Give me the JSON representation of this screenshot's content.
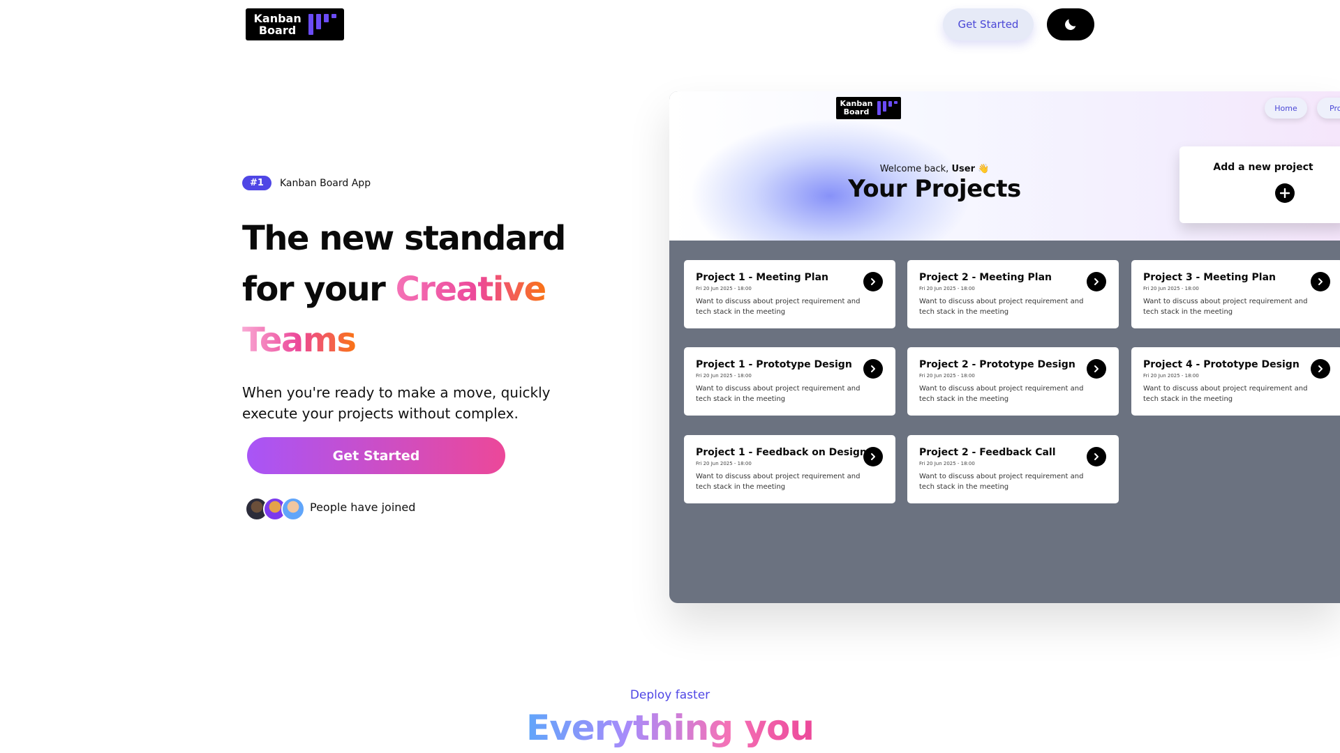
{
  "header": {
    "logo_text": "Kanban Board",
    "get_started_label": "Get Started",
    "theme_toggle_icon": "moon-icon"
  },
  "hero": {
    "badge": "#1",
    "badge_label": "Kanban Board App",
    "headline_line1": "The new standard",
    "headline_line2_prefix": "for your ",
    "headline_highlight1": "Creative",
    "headline_highlight2": "Teams",
    "subtext": "When you're ready to make a move, quickly execute your projects without complex.",
    "cta_label": "Get Started",
    "joined_text": "People have joined"
  },
  "preview": {
    "logo_text": "Kanban Board",
    "nav": [
      "Home",
      "Pro"
    ],
    "welcome_prefix": "Welcome back, ",
    "welcome_user": "User",
    "welcome_emoji": "👋",
    "title": "Your Projects",
    "add_project_label": "Add a new project",
    "projects": [
      {
        "title": "Project 1 - Meeting Plan",
        "date": "Fri 20 Jun 2025 - 18:00",
        "desc": "Want to discuss about project requirement and tech stack in the meeting"
      },
      {
        "title": "Project 2 - Meeting Plan",
        "date": "Fri 20 Jun 2025 - 18:00",
        "desc": "Want to discuss about project requirement and tech stack in the meeting"
      },
      {
        "title": "Project 3 - Meeting Plan",
        "date": "Fri 20 Jun 2025 - 18:00",
        "desc": "Want to discuss about project requirement and tech stack in the meeting"
      },
      {
        "title": "Project 1 - Prototype Design",
        "date": "Fri 20 Jun 2025 - 18:00",
        "desc": "Want to discuss about project requirement and tech stack in the meeting"
      },
      {
        "title": "Project 2 - Prototype Design",
        "date": "Fri 20 Jun 2025 - 18:00",
        "desc": "Want to discuss about project requirement and tech stack in the meeting"
      },
      {
        "title": "Project 4 - Prototype Design",
        "date": "Fri 20 Jun 2025 - 18:00",
        "desc": "Want to discuss about project requirement and tech stack in the meeting"
      },
      {
        "title": "Project 1 - Feedback on Design",
        "date": "Fri 20 Jun 2025 - 18:00",
        "desc": "Want to discuss about project requirement and tech stack in the meeting"
      },
      {
        "title": "Project 2 - Feedback Call",
        "date": "Fri 20 Jun 2025 - 18:00",
        "desc": "Want to discuss about project requirement and tech stack in the meeting"
      }
    ]
  },
  "features": {
    "eyebrow": "Deploy faster",
    "heading": "Everything you"
  },
  "colors": {
    "accent": "#4f46e5",
    "cta_gradient_start": "#a855f7",
    "cta_gradient_end": "#ec4899",
    "preview_bg": "#6b7280"
  }
}
